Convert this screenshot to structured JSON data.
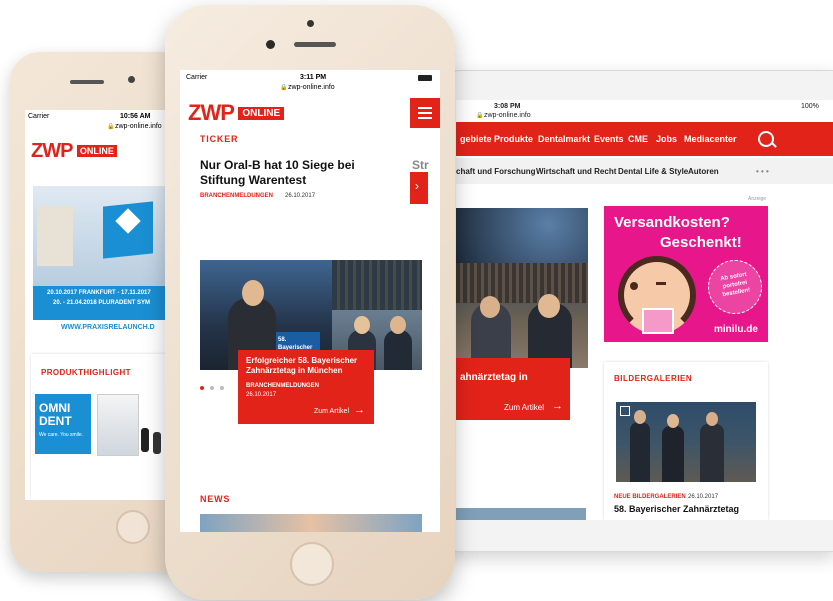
{
  "left_phone": {
    "status_carrier": "Carrier",
    "status_time": "10:56 AM",
    "url": "zwp-online.info",
    "logo_main": "ZWP",
    "logo_badge": "ONLINE",
    "banner_line1": "20.10.2017 FRANKFURT - 17.11.2017",
    "banner_line2": "20. - 21.04.2018 PLURADENT SYM",
    "banner_url": "WWW.PRAXISRELAUNCH.D",
    "section_title": "PRODUKTHIGHLIGHT",
    "product_brand": "OMNI DENT",
    "product_tagline": "We care. You smile."
  },
  "center_phone": {
    "status_carrier": "Carrier",
    "status_time": "3:11 PM",
    "url": "zwp-online.info",
    "logo_main": "ZWP",
    "logo_badge": "ONLINE",
    "section_ticker": "TICKER",
    "ticker_headline": "Nur Oral-B hat 10 Siege bei Stiftung Warentest",
    "ticker_category": "BRANCHENMELDUNGEN",
    "ticker_date": "26.10.2017",
    "ticker_next_peek": "Str",
    "sign_text": "58. Bayerischer Zahnärztetag",
    "card_headline": "Erfolgreicher 58. Bayerischer Zahnärztetag in München",
    "card_category": "BRANCHENMELDUNGEN",
    "card_date": "26.10.2017",
    "card_link": "Zum Artikel",
    "section_news": "NEWS"
  },
  "tablet": {
    "status_time": "3:08 PM",
    "status_battery": "100%",
    "url": "zwp-online.info",
    "nav_items": [
      "gebiete",
      "Produkte",
      "Dentalmarkt",
      "Events",
      "CME",
      "Jobs",
      "Mediacenter"
    ],
    "sub_items": [
      "chaft und Forschung",
      "Wirtschaft und Recht",
      "Dental Life & Style",
      "Autoren"
    ],
    "more": "• • •",
    "card_headline": "ahnärztetag in",
    "card_link": "Zum Artikel",
    "ad_label": "Anzeige",
    "ad_title1": "Versandkosten?",
    "ad_title2": "Geschenkt!",
    "ad_sticker": "Ab sofort portofrei bestellen!",
    "ad_brand": "minilu.de",
    "gallery_title": "BILDERGALERIEN",
    "gallery_category": "NEUE BILDERGALERIEN",
    "gallery_date": "26.10.2017",
    "gallery_headline": "58. Bayerischer Zahnärztetag"
  },
  "colors": {
    "brand_red": "#e2231a",
    "ad_pink": "#e8168b",
    "banner_blue": "#1a8fd3"
  }
}
